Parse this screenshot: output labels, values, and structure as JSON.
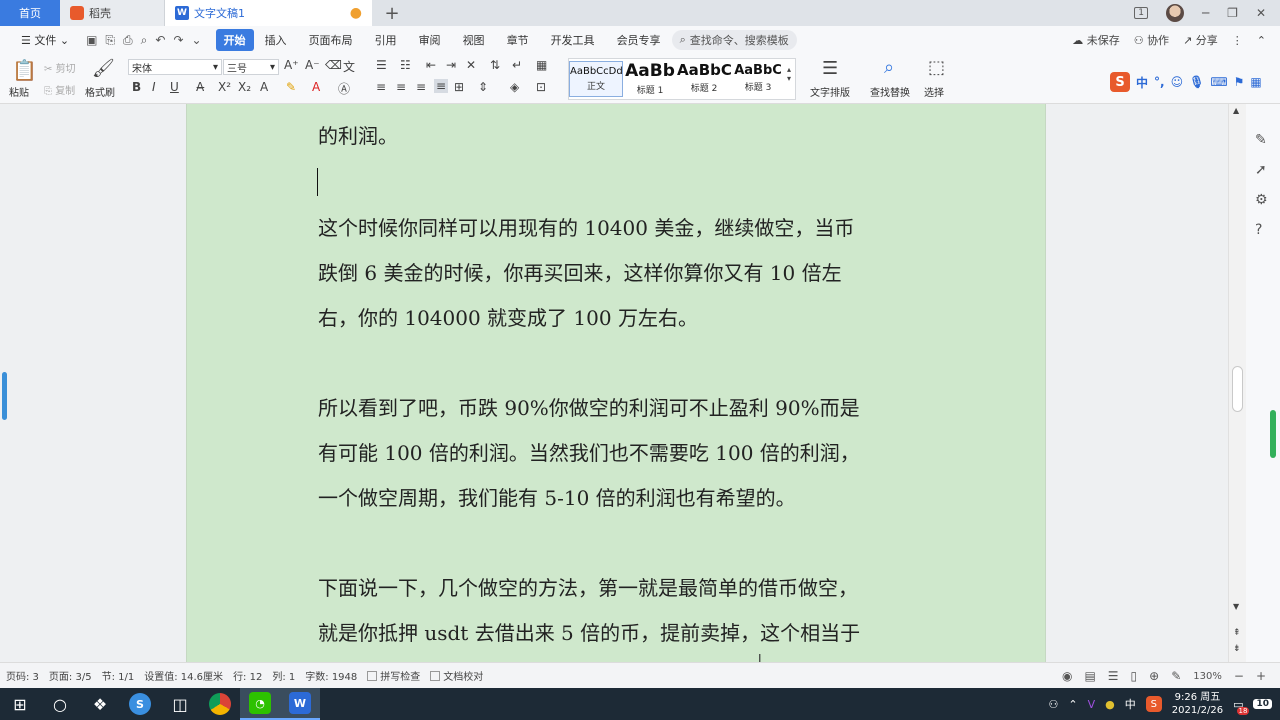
{
  "tabs": {
    "home": "首页",
    "docer": "稻壳",
    "document": "文字文稿1",
    "add": "+",
    "window_badge": "1"
  },
  "menu": {
    "file": "文件",
    "items": [
      "开始",
      "插入",
      "页面布局",
      "引用",
      "审阅",
      "视图",
      "章节",
      "开发工具",
      "会员专享"
    ],
    "active_index": 0,
    "search_placeholder": "查找命令、搜索模板",
    "unsaved": "未保存",
    "collaborate": "协作",
    "share": "分享"
  },
  "ribbon": {
    "paste": "粘贴",
    "cut": "剪切",
    "copy": "复制",
    "format_painter": "格式刷",
    "font_name": "宋体",
    "font_size": "三号",
    "styles": [
      {
        "sample": "AaBbCcDd",
        "name": "正文"
      },
      {
        "sample": "AaBb",
        "name": "标题 1"
      },
      {
        "sample": "AaBbC",
        "name": "标题 2"
      },
      {
        "sample": "AaBbC",
        "name": "标题 3"
      }
    ],
    "text_layout": "文字排版",
    "find_replace": "查找替换",
    "select": "选择",
    "ime_label": "中"
  },
  "document": {
    "paragraphs": [
      {
        "lines": [
          "的利润。"
        ]
      },
      {
        "lines": [
          "这个时候你同样可以用现有的 10400 美金，继续做空，当币",
          "跌倒 6 美金的时候，你再买回来，这样你算你又有 10 倍左",
          "右，你的 104000 就变成了 100 万左右。"
        ]
      },
      {
        "lines": [
          "所以看到了吧，币跌 90%你做空的利润可不止盈利 90%而是",
          "有可能 100 倍的利润。当然我们也不需要吃 100 倍的利润，",
          "一个做空周期，我们能有 5-10 倍的利润也有希望的。"
        ]
      },
      {
        "lines": [
          "下面说一下，几个做空的方法，第一就是最简单的借币做空，",
          "就是你抵押 usdt 去借出来 5 倍的币，提前卖掉，这个相当于"
        ]
      }
    ]
  },
  "status": {
    "page_code": "页码: 3",
    "pages": "页面: 3/5",
    "section": "节: 1/1",
    "setting": "设置值: 14.6厘米",
    "row": "行: 12",
    "col": "列: 1",
    "word_count": "字数: 1948",
    "spell_check": "拼写检查",
    "doc_proof": "文档校对",
    "zoom": "130%"
  },
  "taskbar": {
    "ime": "中",
    "time": "9:26 周五",
    "date": "2021/2/26",
    "notification_count": "10",
    "badge": "18"
  }
}
